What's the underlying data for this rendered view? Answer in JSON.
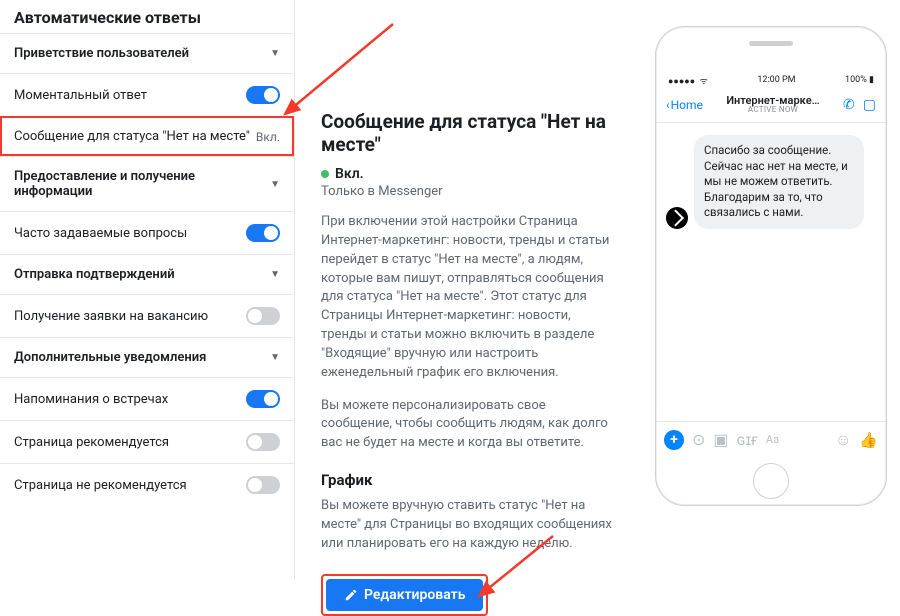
{
  "sidebar": {
    "title": "Автоматические ответы",
    "sections": [
      {
        "label": "Приветствие пользователей"
      },
      {
        "label": "Предоставление и получение информации"
      },
      {
        "label": "Отправка подтверждений"
      },
      {
        "label": "Дополнительные уведомления"
      }
    ],
    "instant_reply": {
      "label": "Моментальный ответ",
      "on": true
    },
    "away_msg": {
      "label": "Сообщение для статуса \"Нет на месте\"",
      "state": "Вкл."
    },
    "faq": {
      "label": "Часто задаваемые вопросы",
      "on": true
    },
    "job_app": {
      "label": "Получение заявки на вакансию",
      "on": false
    },
    "meeting_reminders": {
      "label": "Напоминания о встречах",
      "on": true
    },
    "page_recommended": {
      "label": "Страница рекомендуется",
      "on": false
    },
    "page_not_recommended": {
      "label": "Страница не рекомендуется",
      "on": false
    }
  },
  "main": {
    "heading": "Сообщение для статуса \"Нет на месте\"",
    "status": "Вкл.",
    "messenger_only": "Только в Messenger",
    "description": "При включении этой настройки Страница Интернет-маркетинг: новости, тренды и статьи перейдет в статус \"Нет на месте\", а людям, которые вам пишут, отправляться сообщения для статуса \"Нет на месте\". Этот статус для Страницы Интернет-маркетинг: новости, тренды и статьи можно включить в разделе \"Входящие\" вручную или настроить еженедельный график его включения.",
    "description2": "Вы можете персонализировать свое сообщение, чтобы сообщить людям, как долго вас не будет на месте и когда вы ответите.",
    "schedule_heading": "График",
    "schedule_text": "Вы можете вручную ставить статус \"Нет на месте\" для Страницы во входящих сообщениях или планировать его на каждую неделю.",
    "edit_button": "Редактировать"
  },
  "phone": {
    "status_time": "12:00 PM",
    "status_battery": "100%",
    "back": "Home",
    "title": "Интернет-марке…",
    "subtitle": "active now",
    "message": "Спасибо за сообщение. Сейчас нас нет на месте, и мы не можем ответить. Благодарим за то, что связались с нами.",
    "input_placeholder": "Aa"
  }
}
